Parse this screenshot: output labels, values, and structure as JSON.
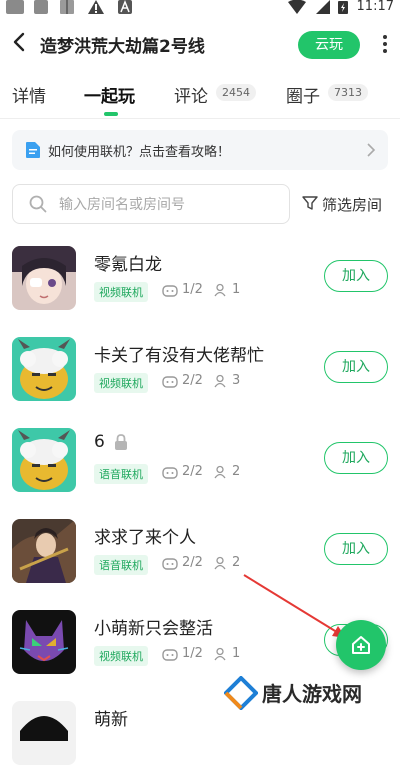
{
  "status_bar": {
    "time": "11:17"
  },
  "header": {
    "title": "造梦洪荒大劫篇2号线",
    "cloud_button": "云玩"
  },
  "tabs": [
    {
      "label": "详情"
    },
    {
      "label": "一起玩",
      "active": true
    },
    {
      "label": "评论",
      "badge": "2454"
    },
    {
      "label": "圈子",
      "badge": "7313"
    }
  ],
  "tip": {
    "text": "如何使用联机？点击查看攻略！"
  },
  "search": {
    "placeholder": "输入房间名或房间号",
    "value": "",
    "filter_label": "筛选房间"
  },
  "rooms": [
    {
      "name": "零氪白龙",
      "tag": "视频联机",
      "players": "1/2",
      "viewers": "1",
      "join": "加入",
      "locked": false
    },
    {
      "name": "卡关了有没有大佬帮忙",
      "tag": "视频联机",
      "players": "2/2",
      "viewers": "3",
      "join": "加入",
      "locked": false
    },
    {
      "name": "6",
      "tag": "语音联机",
      "players": "2/2",
      "viewers": "2",
      "join": "加入",
      "locked": true
    },
    {
      "name": "求求了来个人",
      "tag": "语音联机",
      "players": "2/2",
      "viewers": "2",
      "join": "加入",
      "locked": false
    },
    {
      "name": "小萌新只会整活",
      "tag": "视频联机",
      "players": "1/2",
      "viewers": "1",
      "join": "加入",
      "locked": false
    },
    {
      "name": "萌新"
    }
  ],
  "watermark": {
    "text": "唐人游戏网"
  },
  "colors": {
    "accent": "#22c56a",
    "tag_bg": "#e7f8ee",
    "tag_text": "#1fa85d",
    "annotation": "#e53935"
  }
}
